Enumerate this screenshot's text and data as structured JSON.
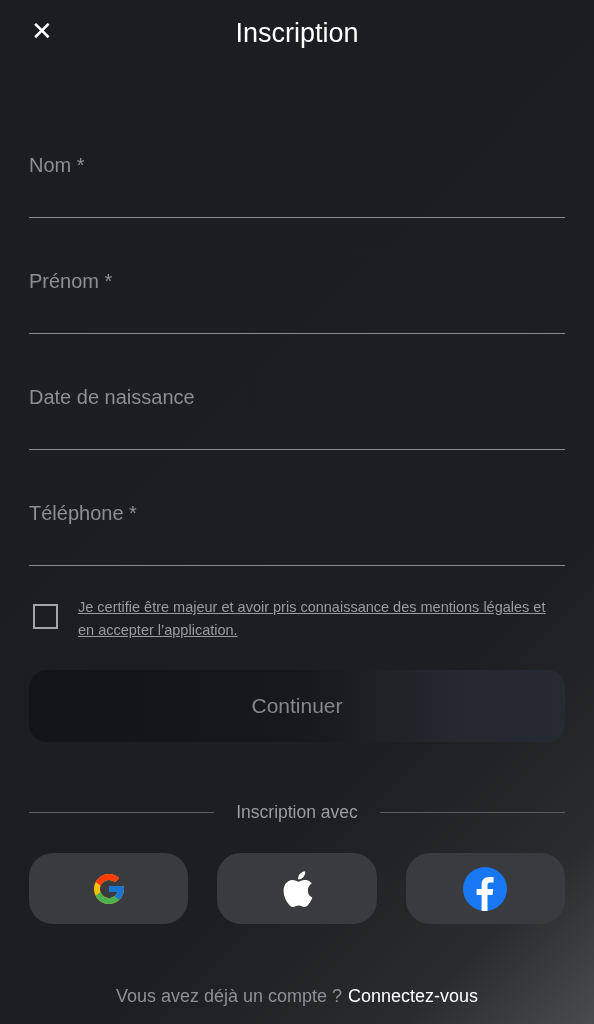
{
  "header": {
    "close": "✕",
    "title": "Inscription"
  },
  "fields": [
    {
      "placeholder": "Nom *"
    },
    {
      "placeholder": "Prénom *"
    },
    {
      "placeholder": "Date de naissance"
    },
    {
      "placeholder": "Téléphone *"
    }
  ],
  "consent": {
    "checked": false,
    "text": "Je certifie être majeur et avoir pris connaissance des mentions légales et en accepter l’application."
  },
  "continue_button": {
    "label": "Continuer",
    "disabled": true
  },
  "divider": "Inscription avec",
  "social_buttons": [
    {
      "kind": "google"
    },
    {
      "kind": "apple"
    },
    {
      "kind": "facebook"
    }
  ],
  "footer": {
    "question": "Vous avez déjà un compte ?",
    "link": "Connectez-vous"
  }
}
